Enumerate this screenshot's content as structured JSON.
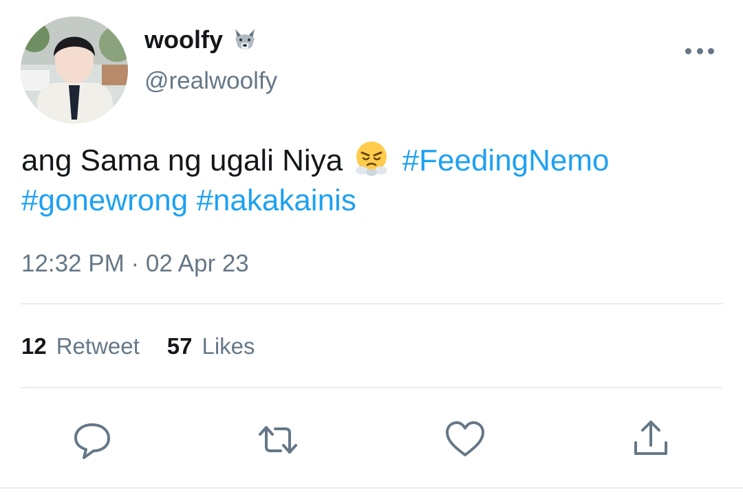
{
  "user": {
    "display_name": "woolfy",
    "name_emoji": "wolf-face-icon",
    "handle": "@realwoolfy"
  },
  "tweet": {
    "text_parts": [
      "ang Sama ng ugali Niya",
      "#FeedingNemo",
      "#gonewrong",
      "#nakakainis"
    ],
    "text_emoji": "face-with-steam-icon",
    "timestamp": "12:32 PM · 02 Apr 23"
  },
  "stats": {
    "retweet_count": "12",
    "retweet_label": "Retweet",
    "likes_count": "57",
    "likes_label": "Likes"
  },
  "actions": [
    "reply-icon",
    "retweet-icon",
    "like-icon",
    "share-icon"
  ],
  "colors": {
    "link": "#1da1f2",
    "secondary_text": "#657786",
    "primary_text": "#14171a",
    "divider": "#e6ecf0"
  }
}
